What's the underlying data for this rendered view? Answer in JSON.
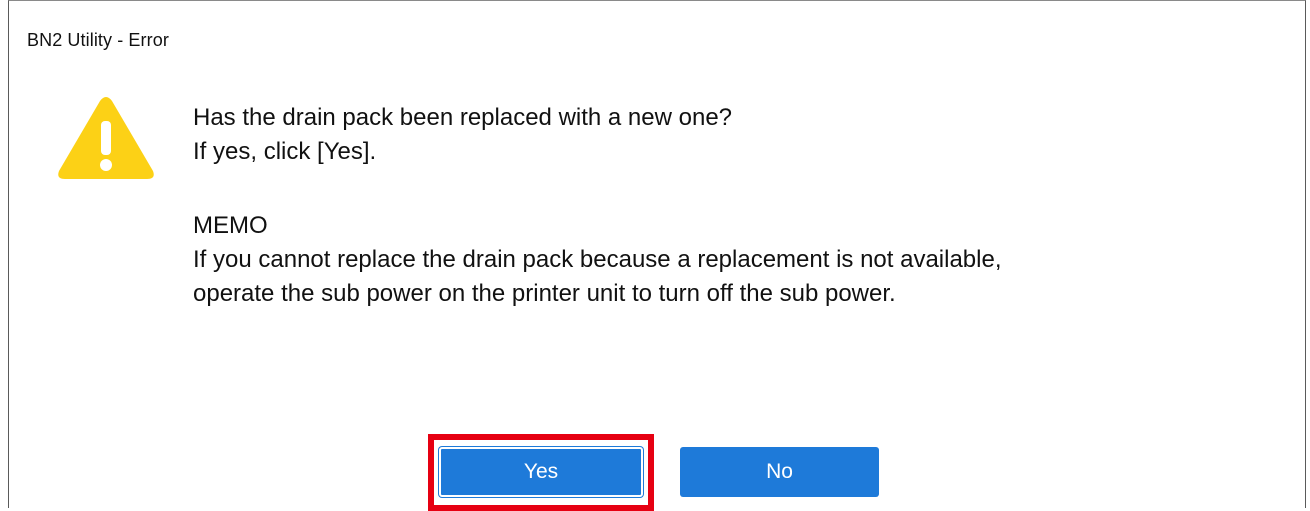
{
  "window": {
    "title": "BN2 Utility - Error"
  },
  "icon": {
    "name": "warning-icon",
    "color": "#FCD116"
  },
  "message": {
    "question": "Has the drain pack been replaced with a new one?",
    "instruction": "If yes, click [Yes].",
    "memo_heading": "MEMO",
    "memo_line1": "If you cannot replace the drain pack because a replacement is not available,",
    "memo_line2": "operate the sub power on the printer unit to turn off the sub power."
  },
  "buttons": {
    "yes_label": "Yes",
    "no_label": "No"
  },
  "colors": {
    "button": "#1E7AD9",
    "highlight": "#E60012"
  }
}
